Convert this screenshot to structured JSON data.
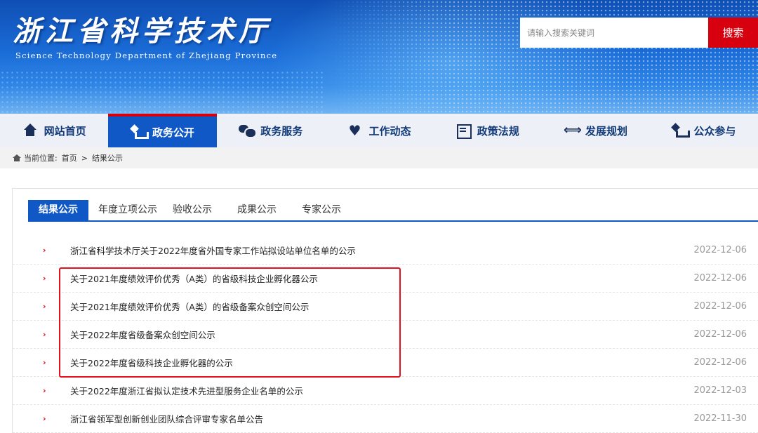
{
  "header": {
    "site_title": "浙江省科学技术厅",
    "site_subtitle": "Science Technology Department of Zhejiang Province",
    "search_placeholder": "请输入搜索关键词",
    "search_button": "搜索"
  },
  "nav": {
    "items": [
      {
        "label": "网站首页",
        "icon": "home-icon"
      },
      {
        "label": "政务公开",
        "icon": "gov-icon",
        "active": true
      },
      {
        "label": "政务服务",
        "icon": "chat-icon"
      },
      {
        "label": "工作动态",
        "icon": "heart-icon"
      },
      {
        "label": "政策法规",
        "icon": "list-icon"
      },
      {
        "label": "发展规划",
        "icon": "handshake-icon"
      },
      {
        "label": "公众参与",
        "icon": "gov-icon"
      }
    ]
  },
  "breadcrumb": {
    "prefix": "当前位置:",
    "home": "首页",
    "separator": ">",
    "current": "结果公示"
  },
  "tabs": [
    {
      "label": "结果公示",
      "active": true
    },
    {
      "label": "年度立项公示"
    },
    {
      "label": "验收公示"
    },
    {
      "label": "成果公示"
    },
    {
      "label": "专家公示"
    }
  ],
  "list": {
    "bullet": "›",
    "items": [
      {
        "title": "浙江省科学技术厅关于2022年度省外国专家工作站拟设站单位名单的公示",
        "date": "2022-12-06"
      },
      {
        "title": "关于2021年度绩效评价优秀（A类）的省级科技企业孵化器公示",
        "date": "2022-12-06"
      },
      {
        "title": "关于2021年度绩效评价优秀（A类）的省级备案众创空间公示",
        "date": "2022-12-06"
      },
      {
        "title": "关于2022年度省级备案众创空间公示",
        "date": "2022-12-06"
      },
      {
        "title": "关于2022年度省级科技企业孵化器的公示",
        "date": "2022-12-06"
      },
      {
        "title": "关于2022年度浙江省拟认定技术先进型服务企业名单的公示",
        "date": "2022-12-03"
      },
      {
        "title": "浙江省领军型创新创业团队综合评审专家名单公告",
        "date": "2022-11-30"
      }
    ]
  },
  "colors": {
    "accent": "#1158c7",
    "highlight": "#e8101f",
    "search_button": "#d7000f"
  }
}
